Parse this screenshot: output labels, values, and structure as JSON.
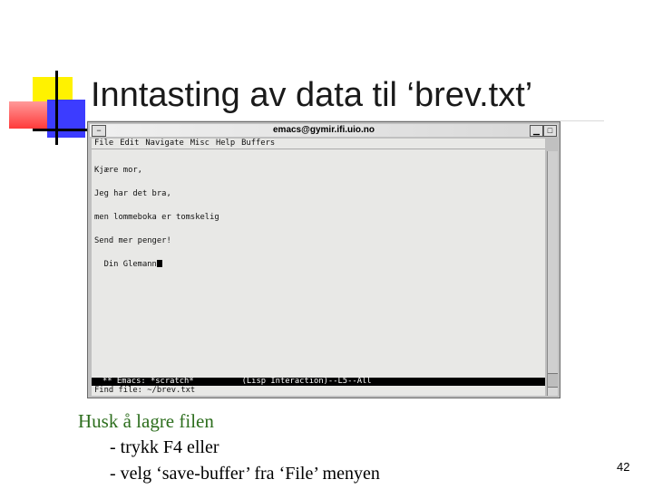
{
  "slide": {
    "title": "Inntasting av data til ‘brev.txt’",
    "page_number": "42",
    "notes": {
      "heading": "Husk å lagre filen",
      "lines": [
        "- trykk F4 eller",
        "- velg ‘save-buffer’ fra ‘File’ menyen"
      ]
    }
  },
  "window": {
    "title": "emacs@gymir.ifi.uio.no",
    "minimize_glyph": "▁",
    "maximize_glyph": "□",
    "system_menu_glyph": "−",
    "menubar": [
      "File",
      "Edit",
      "Navigate",
      "Misc",
      "Help",
      "Buffers"
    ],
    "buffer_lines": [
      "Kjære mor,",
      "Jeg har det bra,",
      "men lommeboka er tomskelig",
      "Send mer penger!",
      "  Din Glemann"
    ],
    "modeline": "** Emacs: *scratch*          (Lisp Interaction)--L5--All",
    "minibuffer": "Find file: ~/brev.txt"
  },
  "colors": {
    "title_text": "#1a1a1a",
    "note_heading": "#2d6e1e",
    "emacs_background": "#e8e8e6",
    "window_frame": "#c0c0c0",
    "modeline_background": "#000000",
    "deco_yellow": "#fff200",
    "deco_blue": "#3c3cff",
    "deco_red": "#ff3a3a"
  }
}
